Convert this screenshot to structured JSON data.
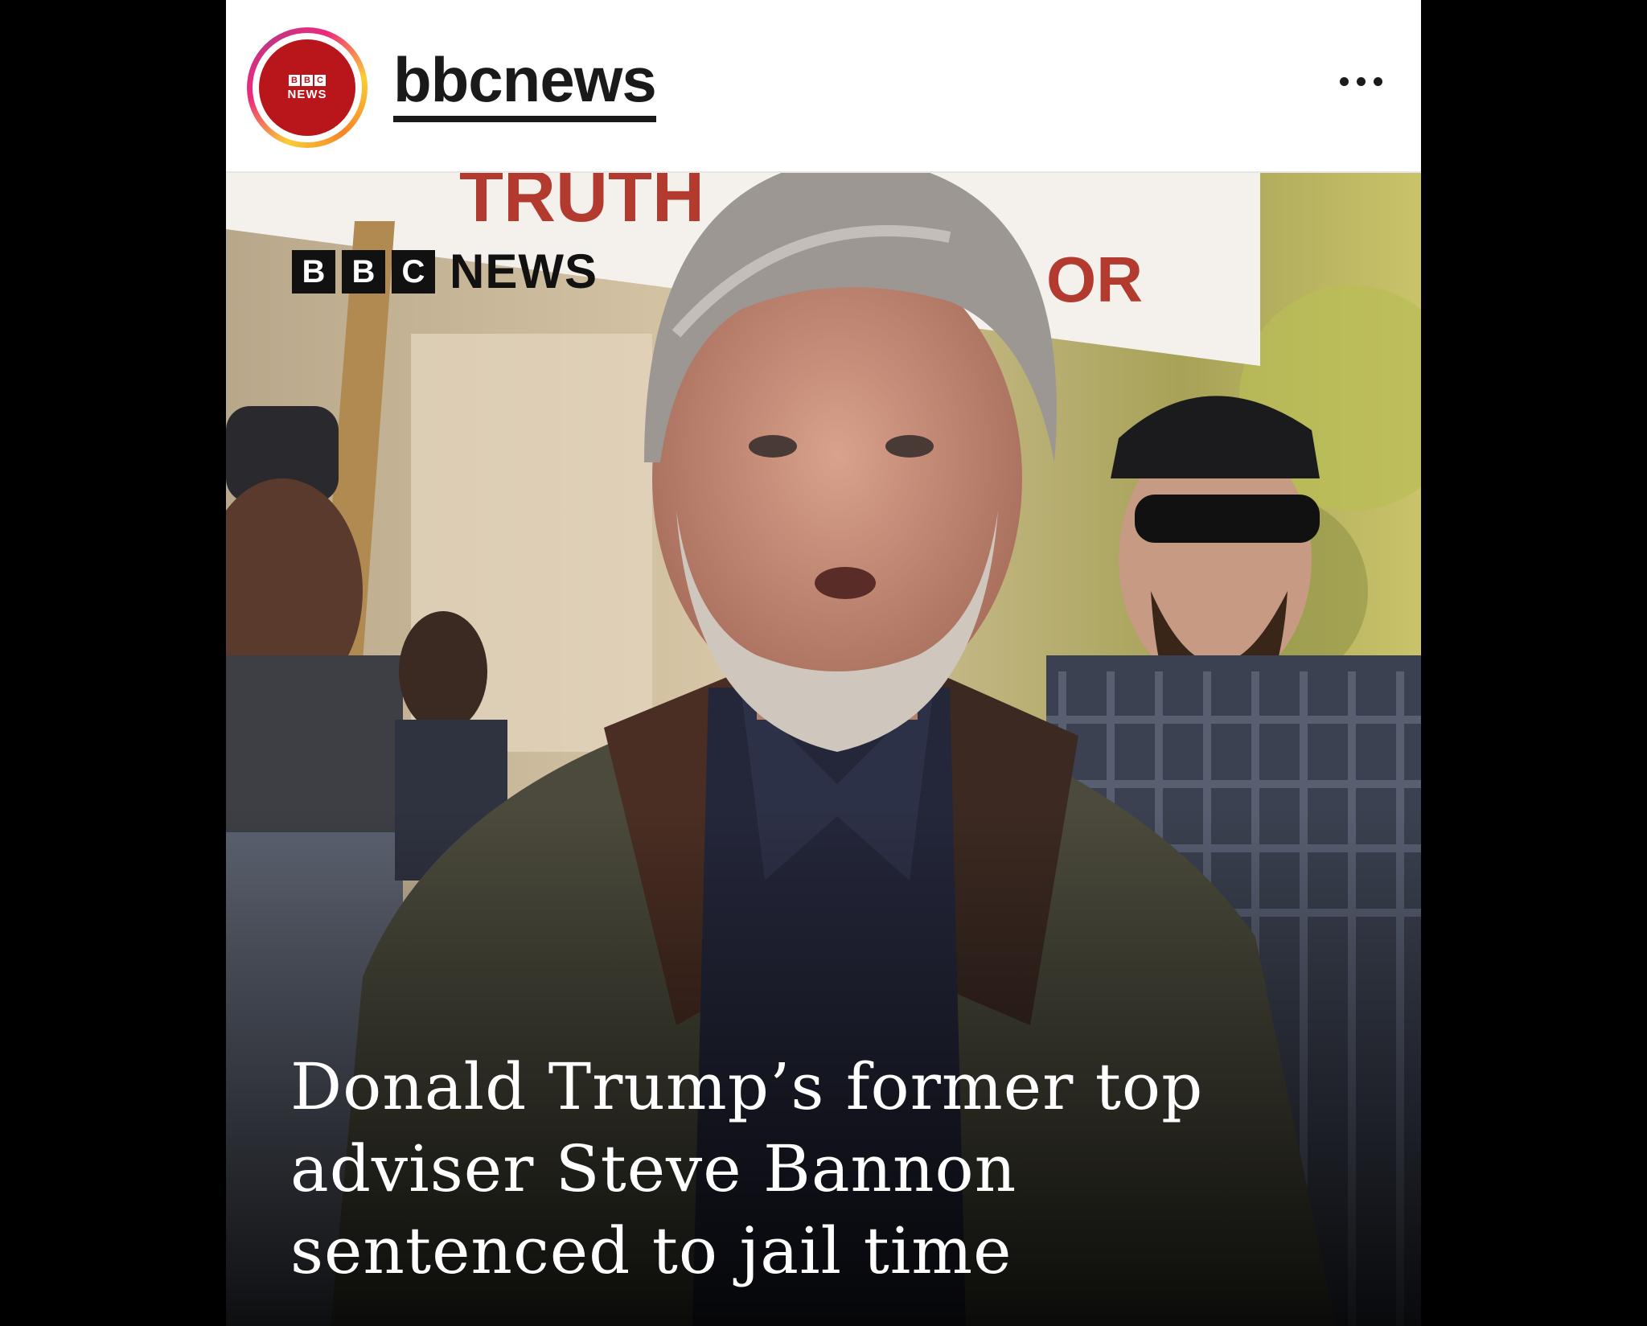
{
  "header": {
    "avatar_badge_letters": [
      "B",
      "B",
      "C"
    ],
    "avatar_badge_word": "NEWS",
    "username": "bbcnews",
    "more_icon": "more-horizontal-icon"
  },
  "post": {
    "watermark_letters": [
      "B",
      "B",
      "C"
    ],
    "watermark_word": "NEWS",
    "headline_lines": [
      "Donald Trump’s former top",
      "adviser Steve Bannon",
      "sentenced to jail time"
    ]
  },
  "colors": {
    "bbc_red": "#b8161b",
    "text_dark": "#1a1a1a",
    "headline_text": "#ffffff"
  }
}
